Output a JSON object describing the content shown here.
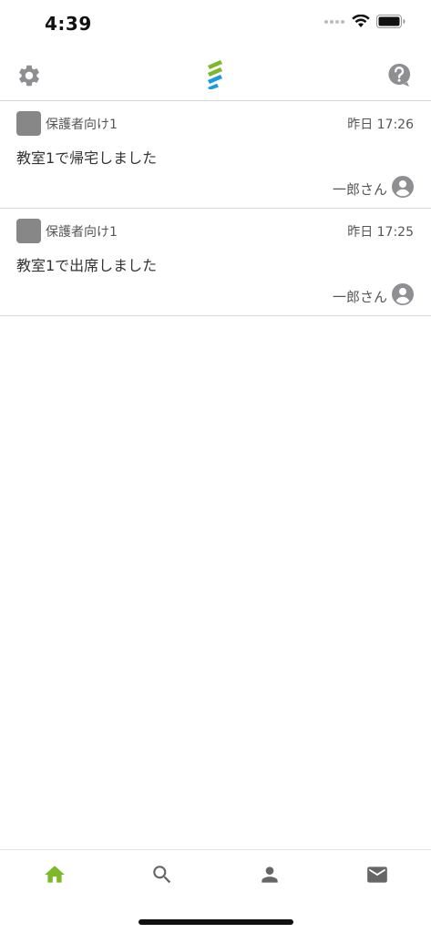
{
  "status_bar": {
    "time": "4:39"
  },
  "nav": {
    "left_icon": "gear-icon",
    "logo_icon": "app-logo-icon",
    "right_icon": "help-icon"
  },
  "feed": {
    "items": [
      {
        "group": "保護者向け1",
        "time": "昨日 17:26",
        "message": "教室1で帰宅しました",
        "sender": "一郎さん"
      },
      {
        "group": "保護者向け1",
        "time": "昨日 17:25",
        "message": "教室1で出席しました",
        "sender": "一郎さん"
      }
    ]
  },
  "tab_bar": {
    "tabs": [
      {
        "icon": "home-icon",
        "active": true
      },
      {
        "icon": "search-icon",
        "active": false
      },
      {
        "icon": "person-icon",
        "active": false
      },
      {
        "icon": "mail-icon",
        "active": false
      }
    ]
  },
  "colors": {
    "accent_green": "#7cb828",
    "logo_blue": "#1d9be0",
    "icon_gray": "#8e8e93",
    "tab_gray": "#666666",
    "divider": "#d6d6d6",
    "thumb_gray": "#878787"
  }
}
